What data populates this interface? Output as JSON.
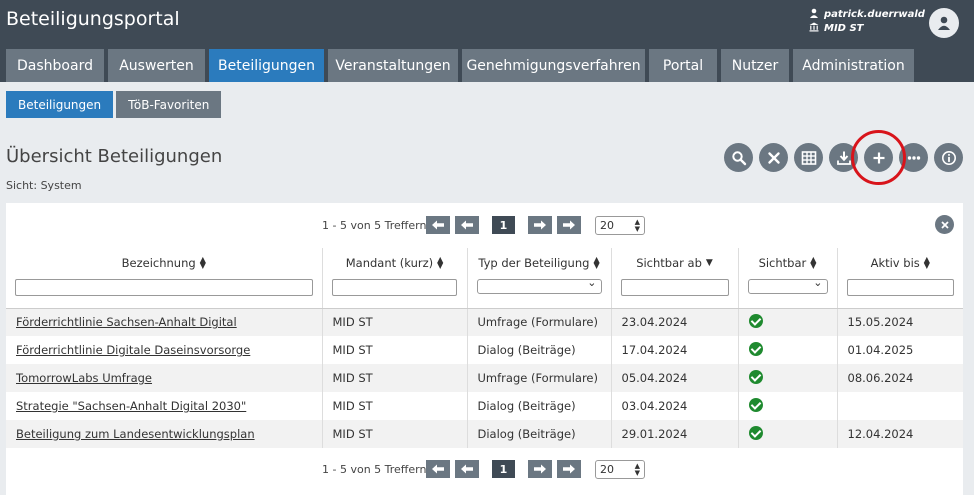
{
  "app": {
    "title": "Beteiligungsportal"
  },
  "user": {
    "name": "patrick.duerrwald",
    "org": "MID ST"
  },
  "nav": [
    {
      "label": "Dashboard"
    },
    {
      "label": "Auswerten"
    },
    {
      "label": "Beteiligungen",
      "active": true
    },
    {
      "label": "Veranstaltungen"
    },
    {
      "label": "Genehmigungsverfahren"
    },
    {
      "label": "Portal"
    },
    {
      "label": "Nutzer"
    },
    {
      "label": "Administration"
    }
  ],
  "subtabs": [
    {
      "label": "Beteiligungen",
      "active": true
    },
    {
      "label": "TöB-Favoriten"
    }
  ],
  "page": {
    "title": "Übersicht Beteiligungen",
    "view": "Sicht: System"
  },
  "actions": [
    "search-icon",
    "clear-icon",
    "table-icon",
    "download-icon",
    "plus-icon",
    "more-icon",
    "info-icon"
  ],
  "pager": {
    "summary": "1 - 5 von 5 Treffern",
    "page": "1",
    "page_size": "20"
  },
  "table": {
    "columns": [
      "Bezeichnung",
      "Mandant (kurz)",
      "Typ der Beteiligung",
      "Sichtbar ab",
      "Sichtbar",
      "Aktiv bis"
    ],
    "rows": [
      {
        "name": "Förderrichtlinie Sachsen-Anhalt Digital",
        "mandant": "MID ST",
        "typ": "Umfrage (Formulare)",
        "ab": "23.04.2024",
        "sichtbar": true,
        "bis": "15.05.2024"
      },
      {
        "name": "Förderrichtlinie Digitale Daseinsvorsorge",
        "mandant": "MID ST",
        "typ": "Dialog (Beiträge)",
        "ab": "17.04.2024",
        "sichtbar": true,
        "bis": "01.04.2025"
      },
      {
        "name": "TomorrowLabs Umfrage",
        "mandant": "MID ST",
        "typ": "Umfrage (Formulare)",
        "ab": "05.04.2024",
        "sichtbar": true,
        "bis": "08.06.2024"
      },
      {
        "name": "Strategie \"Sachsen-Anhalt Digital 2030\"",
        "mandant": "MID ST",
        "typ": "Dialog (Beiträge)",
        "ab": "03.04.2024",
        "sichtbar": true,
        "bis": ""
      },
      {
        "name": "Beteiligung zum Landesentwicklungsplan",
        "mandant": "MID ST",
        "typ": "Dialog (Beiträge)",
        "ab": "29.01.2024",
        "sichtbar": true,
        "bis": "12.04.2024"
      }
    ]
  },
  "colors": {
    "header": "#3f4a55",
    "tab": "#6b7782",
    "active": "#2b7bbd",
    "highlight": "#d8141b",
    "check": "#1f8a2f"
  }
}
